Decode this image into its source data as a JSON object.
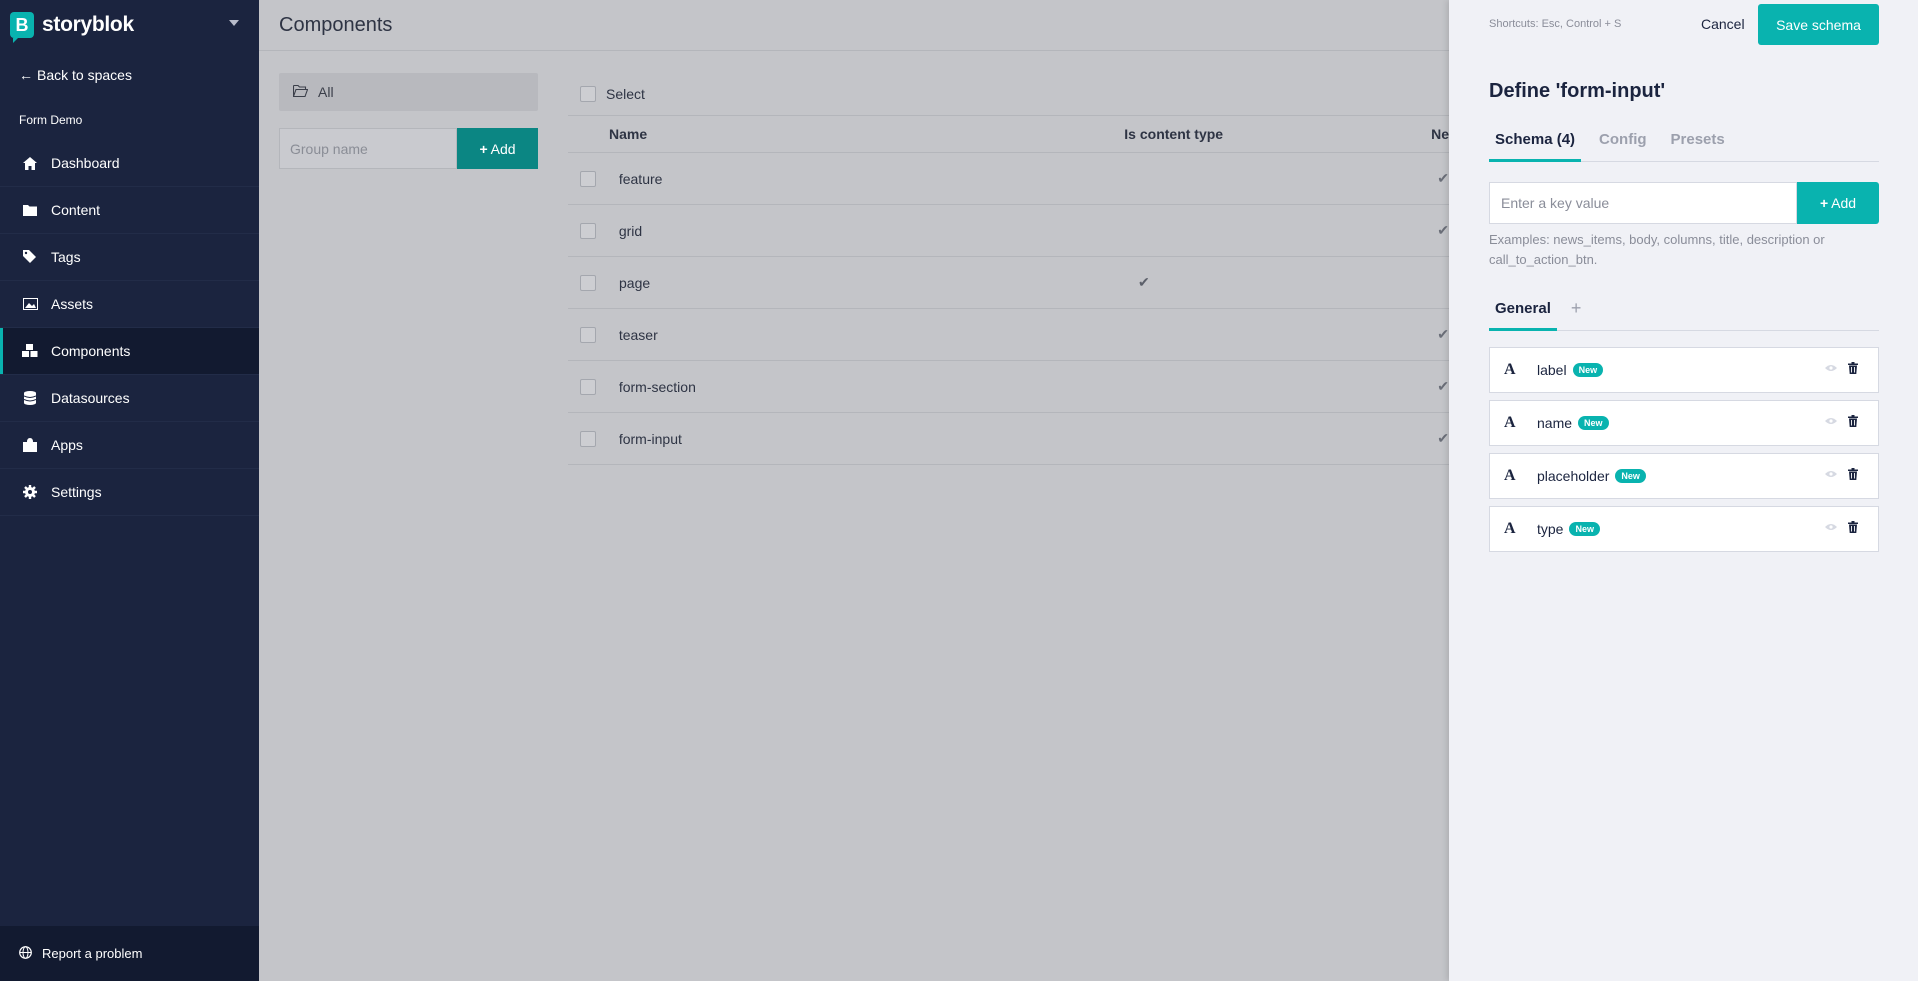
{
  "brand": {
    "logo_letter": "B",
    "name": "storyblok"
  },
  "sidebar": {
    "back_label": "Back to spaces",
    "space_name": "Form Demo",
    "items": [
      {
        "label": "Dashboard",
        "icon": "home-icon"
      },
      {
        "label": "Content",
        "icon": "folder-icon"
      },
      {
        "label": "Tags",
        "icon": "tags-icon"
      },
      {
        "label": "Assets",
        "icon": "image-icon"
      },
      {
        "label": "Components",
        "icon": "cubes-icon",
        "active": true
      },
      {
        "label": "Datasources",
        "icon": "database-icon"
      },
      {
        "label": "Apps",
        "icon": "puzzle-icon"
      },
      {
        "label": "Settings",
        "icon": "gear-icon"
      }
    ],
    "report_label": "Report a problem"
  },
  "main": {
    "title": "Components",
    "groups": {
      "all_label": "All",
      "group_placeholder": "Group name",
      "add_label": "Add"
    },
    "table": {
      "select_label": "Select",
      "columns": [
        "Name",
        "Is content type",
        "Ne"
      ],
      "rows": [
        {
          "name": "feature",
          "content_type": false,
          "nestable": true
        },
        {
          "name": "grid",
          "content_type": false,
          "nestable": true
        },
        {
          "name": "page",
          "content_type": true,
          "nestable": false
        },
        {
          "name": "teaser",
          "content_type": false,
          "nestable": true
        },
        {
          "name": "form-section",
          "content_type": false,
          "nestable": true
        },
        {
          "name": "form-input",
          "content_type": false,
          "nestable": true
        }
      ]
    }
  },
  "panel": {
    "shortcuts": "Shortcuts: Esc, Control + S",
    "cancel_label": "Cancel",
    "save_label": "Save schema",
    "title": "Define 'form-input'",
    "tabs": [
      "Schema (4)",
      "Config",
      "Presets"
    ],
    "key_placeholder": "Enter a key value",
    "add_label": "Add",
    "examples": "Examples: news_items, body, columns, title, description or call_to_action_btn.",
    "general_tab": "General",
    "fields": [
      {
        "name": "label",
        "badge": "New",
        "type_icon": "A"
      },
      {
        "name": "name",
        "badge": "New",
        "type_icon": "A"
      },
      {
        "name": "placeholder",
        "badge": "New",
        "type_icon": "A"
      },
      {
        "name": "type",
        "badge": "New",
        "type_icon": "A"
      }
    ]
  },
  "colors": {
    "accent": "#09b3af",
    "sidebar": "#1b243f",
    "panel_bg": "#f0f1f6"
  }
}
